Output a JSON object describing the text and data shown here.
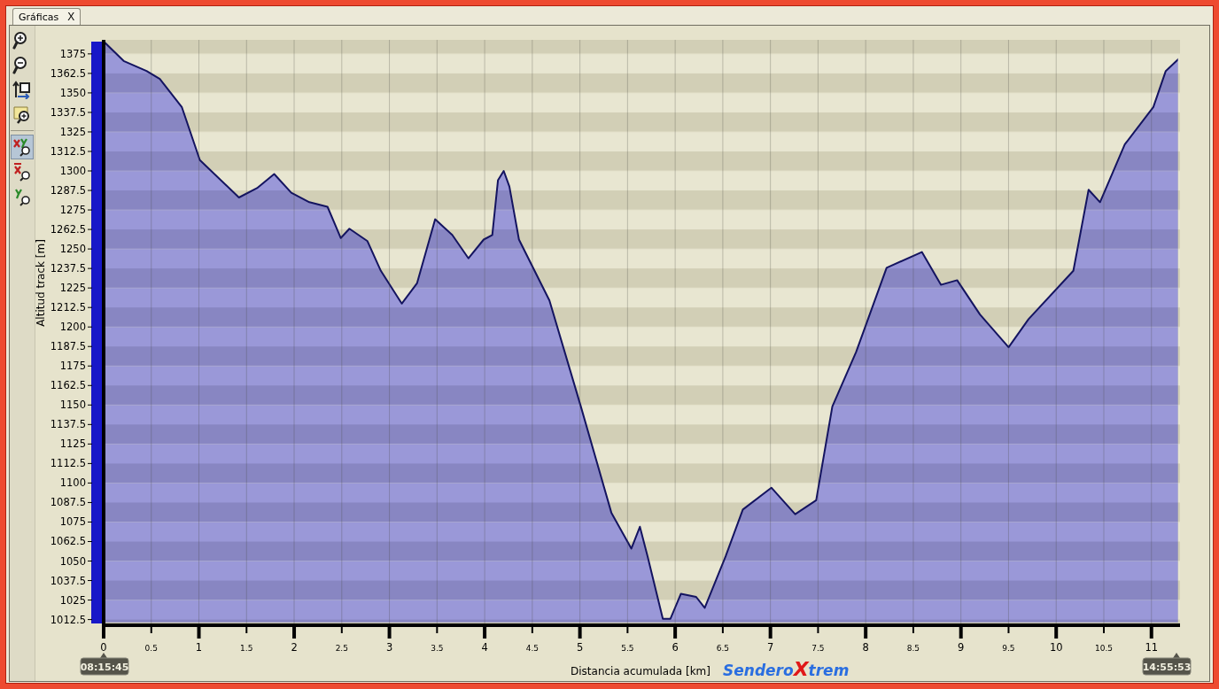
{
  "tabs": [
    {
      "label": "Gráficas",
      "close": "X",
      "selected": true
    }
  ],
  "toolbar": [
    {
      "kind": "zoom-in",
      "selected": false
    },
    {
      "kind": "zoom-out",
      "selected": false
    },
    {
      "kind": "reset",
      "selected": false
    },
    {
      "kind": "zoom-area",
      "selected": false
    },
    {
      "kind": "separator"
    },
    {
      "kind": "zoom-xy",
      "selected": true
    },
    {
      "kind": "zoom-x",
      "selected": false
    },
    {
      "kind": "zoom-y",
      "selected": false
    }
  ],
  "chart": {
    "start_time": "08:15:45",
    "end_time": "14:55:53",
    "logo": [
      "Sendero",
      "X",
      "trem"
    ],
    "chart_data": {
      "type": "area",
      "grid": true,
      "xlabel": "Distancia acumulada [km]",
      "ylabel": "Altitud track [m]",
      "x": [
        0,
        0.21,
        0.45,
        0.59,
        0.82,
        1.01,
        1.42,
        1.61,
        1.79,
        1.97,
        2.16,
        2.35,
        2.49,
        2.58,
        2.77,
        2.91,
        3.13,
        3.29,
        3.48,
        3.66,
        3.83,
        3.99,
        4.08,
        4.14,
        4.2,
        4.26,
        4.36,
        4.68,
        5.01,
        5.33,
        5.54,
        5.63,
        5.71,
        5.87,
        5.95,
        6.06,
        6.22,
        6.31,
        6.53,
        6.71,
        7.01,
        7.26,
        7.48,
        7.65,
        7.9,
        8.22,
        8.59,
        8.79,
        8.96,
        9.2,
        9.5,
        9.71,
        10.18,
        10.34,
        10.46,
        10.72,
        11.02,
        11.15,
        11.29
      ],
      "series": [
        {
          "color": "#141460",
          "values": [
            1383,
            1370.5,
            1364,
            1359,
            1341,
            1307,
            1283,
            1289,
            1298,
            1286,
            1280,
            1277,
            1257,
            1263,
            1255,
            1236,
            1215,
            1228,
            1269,
            1259,
            1244,
            1256,
            1259,
            1294,
            1300,
            1290,
            1256,
            1217,
            1149,
            1081,
            1058,
            1072,
            1053,
            1013,
            1013,
            1029,
            1027,
            1020,
            1053,
            1083,
            1097,
            1080,
            1089,
            1149,
            1184,
            1238,
            1248,
            1227,
            1230,
            1208,
            1187,
            1205,
            1236,
            1288,
            1280,
            1317,
            1341,
            1364,
            1372
          ]
        }
      ],
      "xlim": [
        0,
        11.3
      ],
      "ylim": [
        1010,
        1384
      ],
      "xticks": [
        0,
        0.5,
        1,
        1.5,
        2,
        2.5,
        3,
        3.5,
        4,
        4.5,
        5,
        5.5,
        6,
        6.5,
        7,
        7.5,
        8,
        8.5,
        9,
        9.5,
        10,
        10.5,
        11
      ],
      "yticks": [
        1012.5,
        1025,
        1037.5,
        1050,
        1062.5,
        1075,
        1087.5,
        1100,
        1112.5,
        1125,
        1137.5,
        1150,
        1162.5,
        1175,
        1187.5,
        1200,
        1212.5,
        1225,
        1237.5,
        1250,
        1262.5,
        1275,
        1287.5,
        1300,
        1312.5,
        1325,
        1337.5,
        1350,
        1362.5,
        1375
      ]
    }
  }
}
